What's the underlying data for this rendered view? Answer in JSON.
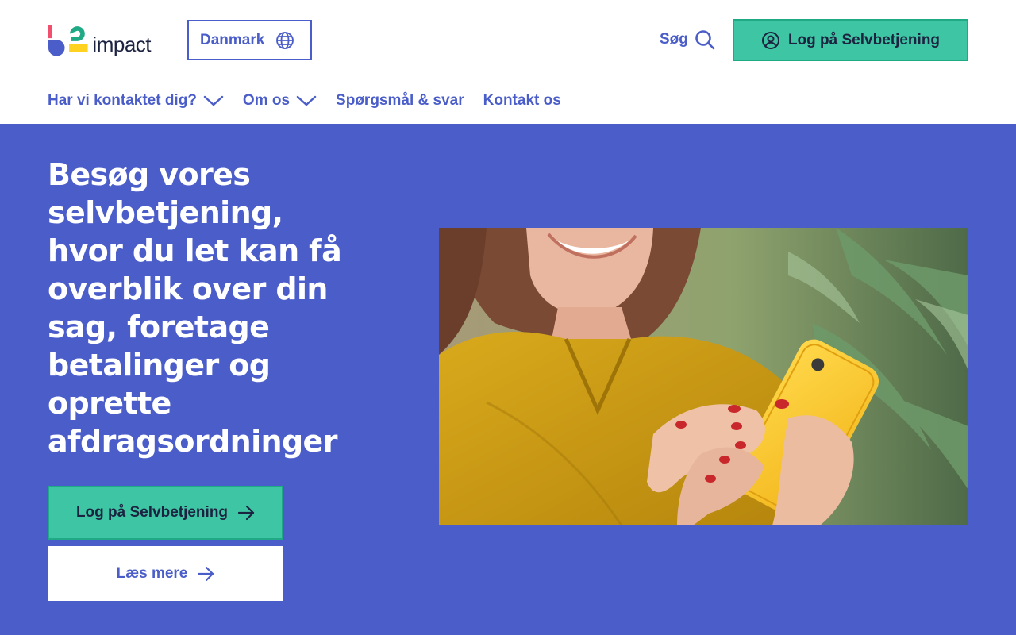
{
  "brand": {
    "logo_text": "impact",
    "colors": {
      "primary_blue": "#4a5dc9",
      "accent_green": "#3ec6a4",
      "logo_red": "#f0506e",
      "logo_yellow": "#ffd21f",
      "dark_text": "#1c2340"
    }
  },
  "header": {
    "country_label": "Danmark",
    "country_icon": "globe-icon",
    "search_label": "Søg",
    "search_icon": "search-icon",
    "login_label": "Log på Selvbetjening",
    "login_icon": "user-circle-icon"
  },
  "nav": {
    "items": [
      {
        "label": "Har vi kontaktet dig?",
        "has_dropdown": true
      },
      {
        "label": "Om os",
        "has_dropdown": true
      },
      {
        "label": "Spørgsmål & svar",
        "has_dropdown": false
      },
      {
        "label": "Kontakt os",
        "has_dropdown": false
      }
    ]
  },
  "hero": {
    "title": "Besøg vores selvbetjening, hvor du let kan få overblik over din sag, foretage betalinger og oprette afdragsordninger",
    "primary_button": "Log på Selvbetjening",
    "secondary_button": "Læs mere",
    "arrow_icon": "arrow-right-icon"
  }
}
